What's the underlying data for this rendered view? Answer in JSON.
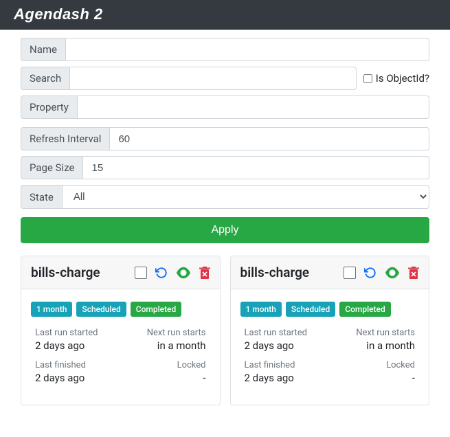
{
  "navbar": {
    "brand": "Agendash 2"
  },
  "filters": {
    "name_label": "Name",
    "name_value": "",
    "search_label": "Search",
    "search_value": "",
    "is_object_id_label": "Is ObjectId?",
    "property_label": "Property",
    "property_value": "",
    "refresh_interval_label": "Refresh Interval",
    "refresh_interval_value": "60",
    "page_size_label": "Page Size",
    "page_size_value": "15",
    "state_label": "State",
    "state_value": "All",
    "apply_label": "Apply"
  },
  "jobs": [
    {
      "title": "bills-charge",
      "badges": {
        "interval": "1 month",
        "scheduled": "Scheduled",
        "completed": "Completed"
      },
      "last_run_started_label": "Last run started",
      "last_run_started_value": "2 days ago",
      "next_run_label": "Next run starts",
      "next_run_value": "in a month",
      "last_finished_label": "Last finished",
      "last_finished_value": "2 days ago",
      "locked_label": "Locked",
      "locked_value": "-"
    },
    {
      "title": "bills-charge",
      "badges": {
        "interval": "1 month",
        "scheduled": "Scheduled",
        "completed": "Completed"
      },
      "last_run_started_label": "Last run started",
      "last_run_started_value": "2 days ago",
      "next_run_label": "Next run starts",
      "next_run_value": "in a month",
      "last_finished_label": "Last finished",
      "last_finished_value": "2 days ago",
      "locked_label": "Locked",
      "locked_value": "-"
    }
  ]
}
